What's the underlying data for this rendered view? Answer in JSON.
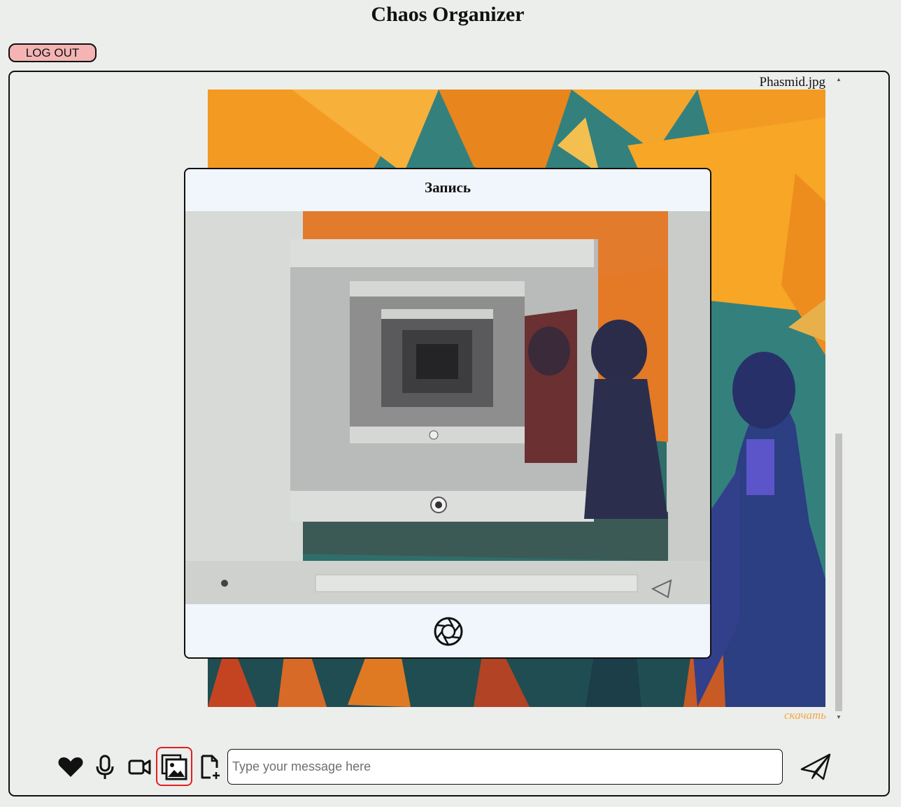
{
  "app": {
    "title": "Chaos Organizer",
    "logout_label": "LOG OUT"
  },
  "message": {
    "filename": "Phasmid.jpg",
    "download_label": "скачать"
  },
  "modal": {
    "title": "Запись"
  },
  "composer": {
    "placeholder": "Type your message here",
    "value": ""
  },
  "icons": {
    "favorite": "heart-icon",
    "audio": "microphone-icon",
    "video": "video-camera-icon",
    "image": "image-upload-icon",
    "file": "file-add-icon",
    "send": "send-icon",
    "shutter": "camera-shutter-icon"
  },
  "colors": {
    "logout_bg": "#f4b4b4",
    "download_link": "#f2a84a",
    "active_tool_border": "#e02020",
    "modal_bg": "#f0f6fb",
    "page_bg": "#eceeeb"
  }
}
